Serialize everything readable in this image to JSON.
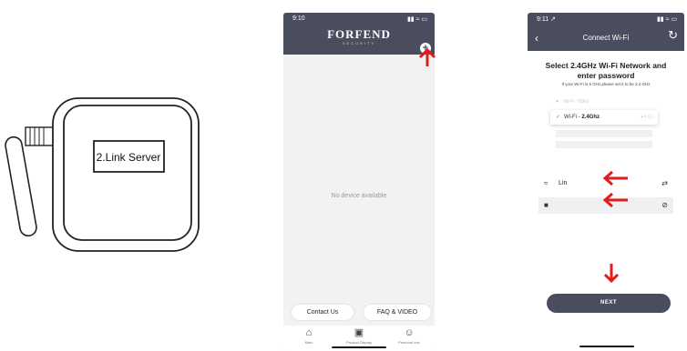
{
  "device": {
    "label": "2.Link Server"
  },
  "phone1": {
    "status_time": "9:10",
    "status_icons": "▮▮ ≈ ▭",
    "brand": "FORFEND",
    "brand_sub": "SECURITY",
    "add_icon": "plus-circle-icon",
    "empty_text": "No device available",
    "contact_label": "Contact Us",
    "faq_label": "FAQ & VIDEO",
    "tabs": [
      {
        "icon": "⌂",
        "label": "Main"
      },
      {
        "icon": "▣",
        "label": "Product Display"
      },
      {
        "icon": "☺",
        "label": "Personal Info"
      }
    ]
  },
  "phone2": {
    "status_time": "9:11 ↗",
    "status_icons": "▮▮ ≈ ▭",
    "title": "Connect Wi-Fi",
    "back_icon": "‹",
    "refresh_icon": "↻",
    "heading": "Select 2.4GHz Wi-Fi Network and enter password",
    "hint": "If your Wi-Fi is 5 GHz,please set it to be 2.4 GHz",
    "networks": [
      {
        "name": "Wi-Fi - 5Ghz",
        "selected": false
      },
      {
        "name_prefix": "Wi-Fi - ",
        "name_bold": "2.4Ghz",
        "selected": true
      }
    ],
    "check_mark": "✓",
    "x_mark": "×",
    "signal_text": "• ≈ ⓘ",
    "ssid_value": "Lin",
    "wifi_icon": "≈",
    "swap_icon": "⇄",
    "lock_icon": "■",
    "eye_icon": "⊘",
    "next_label": "NEXT"
  },
  "colors": {
    "header": "#4a4d5d",
    "arrow": "#e01c1c",
    "background": "#ffffff"
  }
}
